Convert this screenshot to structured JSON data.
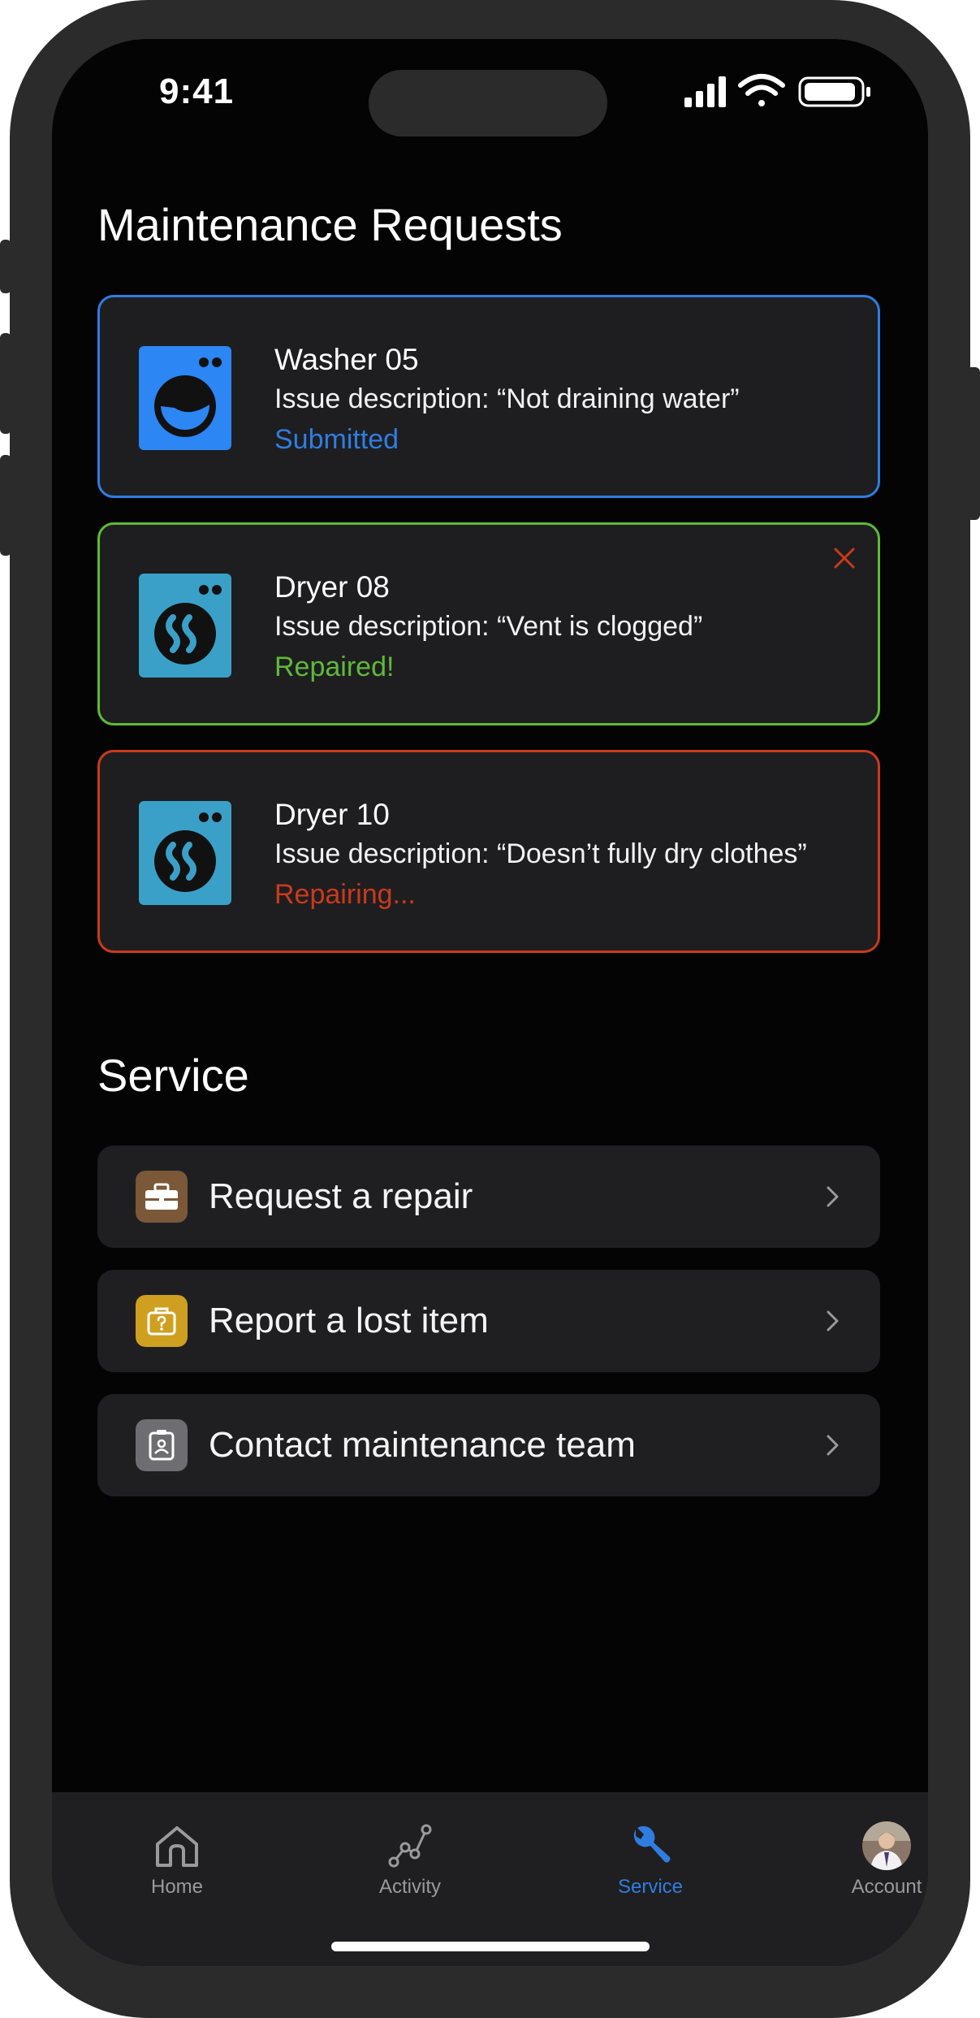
{
  "status_bar": {
    "time": "9:41"
  },
  "maintenance": {
    "title": "Maintenance Requests",
    "requests": [
      {
        "name": "Washer 05",
        "description": "Issue description: “Not draining water”",
        "status": "Submitted",
        "status_color": "#2f7de1",
        "icon": "washer-icon",
        "dismissible": false
      },
      {
        "name": "Dryer 08",
        "description": "Issue description: “Vent is clogged”",
        "status": "Repaired!",
        "status_color": "#5fb93a",
        "icon": "dryer-icon",
        "dismissible": true
      },
      {
        "name": "Dryer 10",
        "description": "Issue description: “Doesn’t fully dry clothes”",
        "status": "Repairing...",
        "status_color": "#c93a1c",
        "icon": "dryer-icon",
        "dismissible": false
      }
    ]
  },
  "service": {
    "title": "Service",
    "items": [
      {
        "label": "Request a repair",
        "icon": "toolbox-icon",
        "icon_color": "#7a5838"
      },
      {
        "label": "Report a lost item",
        "icon": "lost-bag-icon",
        "icon_color": "#cf9f1f"
      },
      {
        "label": "Contact maintenance team",
        "icon": "contact-badge-icon",
        "icon_color": "#6e6e72"
      }
    ]
  },
  "tabbar": {
    "active_color": "#2f7de1",
    "tabs": [
      {
        "label": "Home",
        "icon": "home-icon",
        "active": false
      },
      {
        "label": "Activity",
        "icon": "activity-icon",
        "active": false
      },
      {
        "label": "Service",
        "icon": "wrench-icon",
        "active": true
      },
      {
        "label": "Account",
        "icon": "avatar-icon",
        "active": false
      }
    ]
  }
}
